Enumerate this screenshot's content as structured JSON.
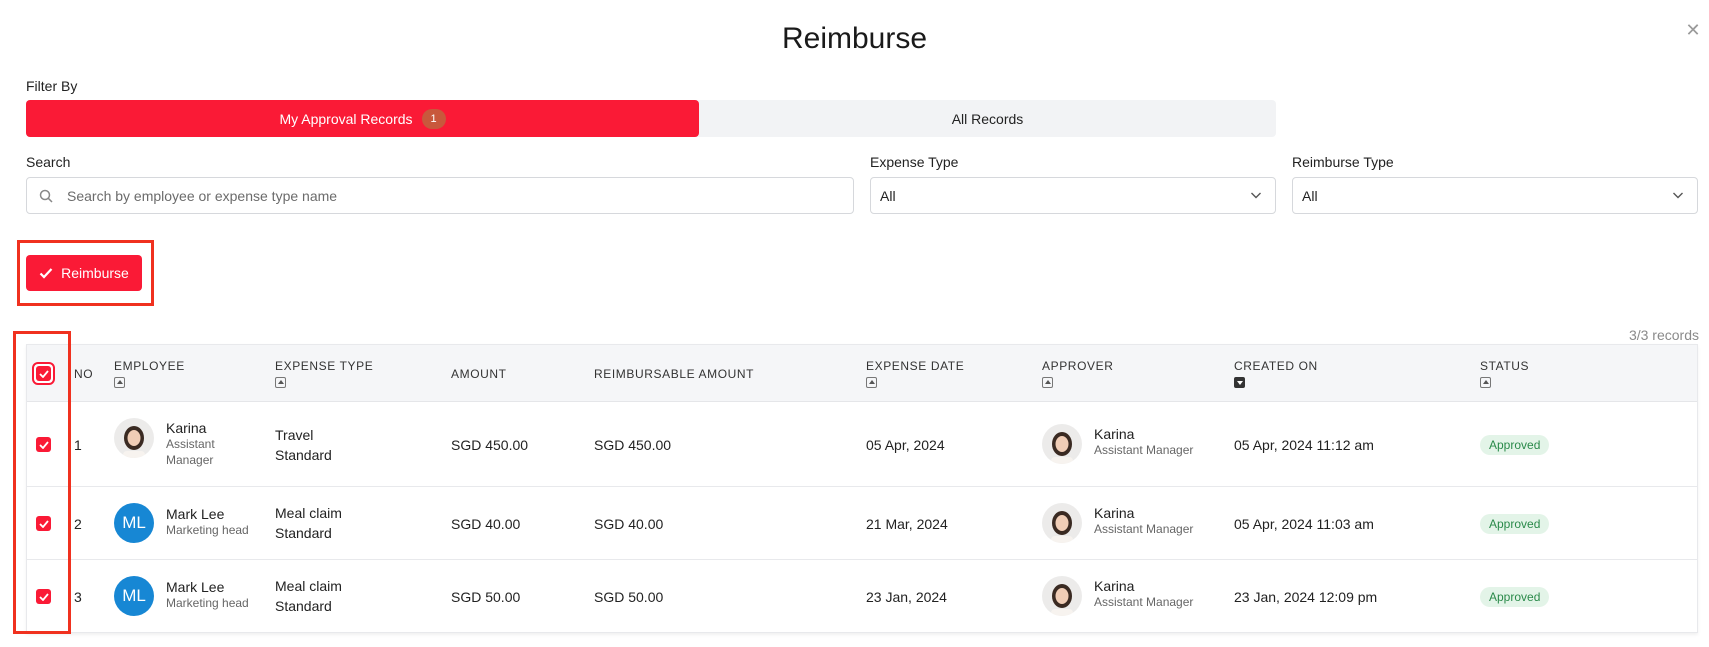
{
  "modal": {
    "title": "Reimburse"
  },
  "filter": {
    "label": "Filter By",
    "tabs": [
      {
        "label": "My Approval Records",
        "badge": "1",
        "active": true
      },
      {
        "label": "All Records",
        "active": false
      }
    ]
  },
  "search": {
    "label": "Search",
    "placeholder": "Search by employee or expense type name"
  },
  "expense_type": {
    "label": "Expense Type",
    "value": "All"
  },
  "reimburse_type": {
    "label": "Reimburse Type",
    "value": "All"
  },
  "actions": {
    "reimburse_label": "Reimburse"
  },
  "records_count": "3/3 records",
  "table": {
    "headers": {
      "no": "NO",
      "employee": "EMPLOYEE",
      "expense_type": "EXPENSE TYPE",
      "amount": "AMOUNT",
      "reimbursable": "REIMBURSABLE AMOUNT",
      "expense_date": "EXPENSE DATE",
      "approver": "APPROVER",
      "created_on": "CREATED ON",
      "status": "STATUS"
    },
    "rows": [
      {
        "no": "1",
        "employee_name": "Karina",
        "employee_role_line1": "Assistant",
        "employee_role_line2": "Manager",
        "expense_type_line1": "Travel",
        "expense_type_line2": "Standard",
        "amount": "SGD 450.00",
        "reimbursable": "SGD 450.00",
        "expense_date": "05 Apr, 2024",
        "approver_name": "Karina",
        "approver_role": "Assistant Manager",
        "created_on": "05 Apr, 2024 11:12 am",
        "status": "Approved"
      },
      {
        "no": "2",
        "employee_initials": "ML",
        "employee_name": "Mark Lee",
        "employee_role": "Marketing head",
        "expense_type_line1": "Meal claim",
        "expense_type_line2": "Standard",
        "amount": "SGD 40.00",
        "reimbursable": "SGD 40.00",
        "expense_date": "21 Mar, 2024",
        "approver_name": "Karina",
        "approver_role": "Assistant Manager",
        "created_on": "05 Apr, 2024 11:03 am",
        "status": "Approved"
      },
      {
        "no": "3",
        "employee_initials": "ML",
        "employee_name": "Mark Lee",
        "employee_role": "Marketing head",
        "expense_type_line1": "Meal claim",
        "expense_type_line2": "Standard",
        "amount": "SGD 50.00",
        "reimbursable": "SGD 50.00",
        "expense_date": "23 Jan, 2024",
        "approver_name": "Karina",
        "approver_role": "Assistant Manager",
        "created_on": "23 Jan, 2024 12:09 pm",
        "status": "Approved"
      }
    ]
  },
  "colors": {
    "accent": "#fa1a36",
    "highlight": "#f0311f",
    "avatar_blue": "#1787d4",
    "approved_bg": "#e3f4e8",
    "approved_text": "#2a8a4a"
  },
  "icons": {
    "close": "close-icon",
    "search": "search-icon",
    "chevron": "chevron-down-icon",
    "check": "check-icon"
  }
}
